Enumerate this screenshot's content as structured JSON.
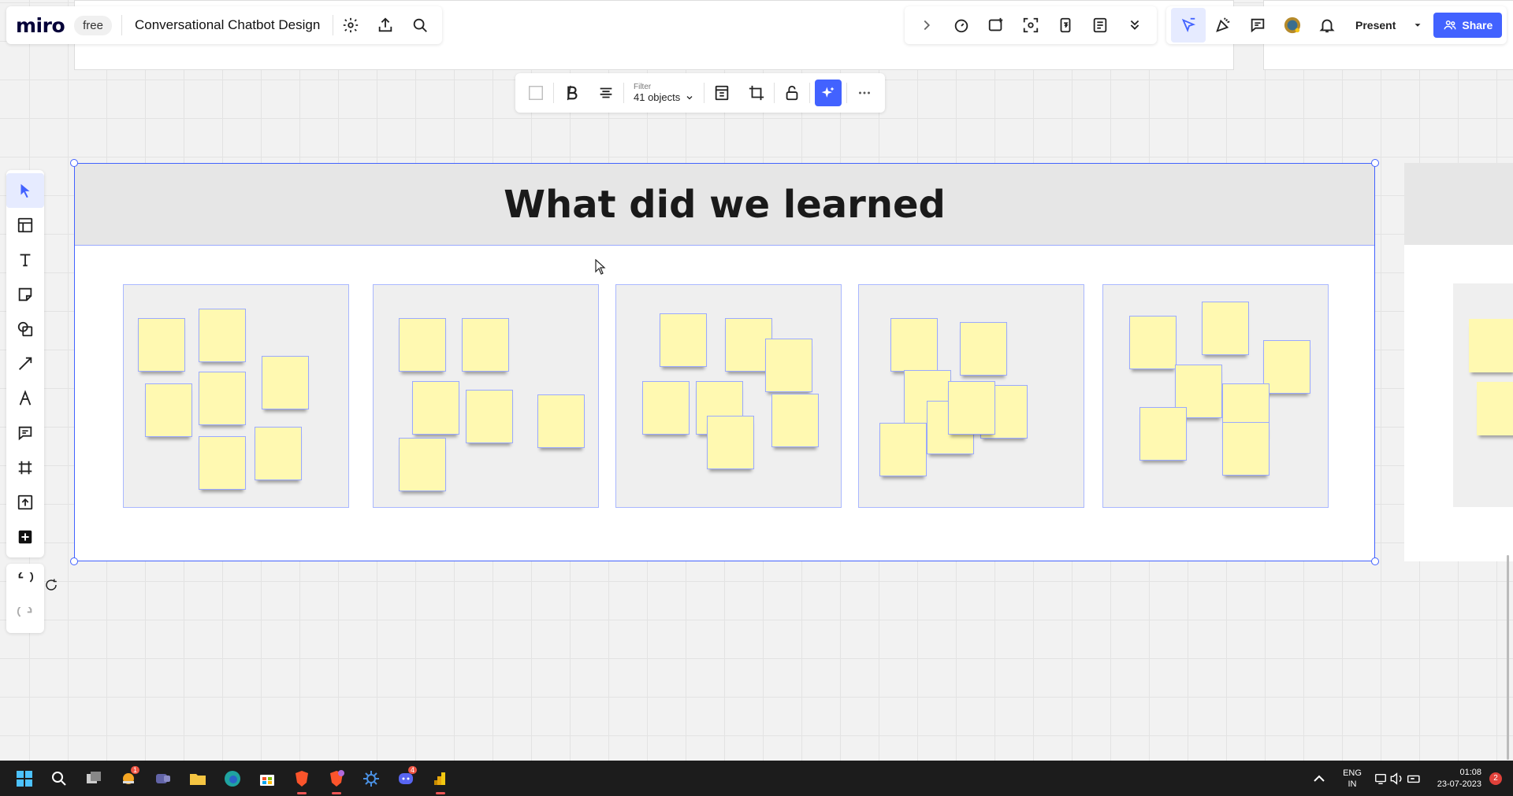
{
  "app": {
    "logo": "miro",
    "plan_badge": "free",
    "board_title": "Conversational Chatbot Design"
  },
  "top_right": {
    "present_label": "Present",
    "share_label": "Share"
  },
  "context_toolbar": {
    "filter_label": "Filter",
    "filter_value": "41 objects"
  },
  "frame": {
    "title": "What did we learned"
  },
  "colors": {
    "accent": "#4262ff",
    "sticky": "#fff9b1",
    "selection": "#4262ff"
  },
  "taskbar": {
    "language_top": "ENG",
    "language_bottom": "IN",
    "time": "01:08",
    "date": "23-07-2023",
    "notification_count": "2",
    "app_badges": {
      "weather": "1",
      "discord": "4"
    }
  }
}
